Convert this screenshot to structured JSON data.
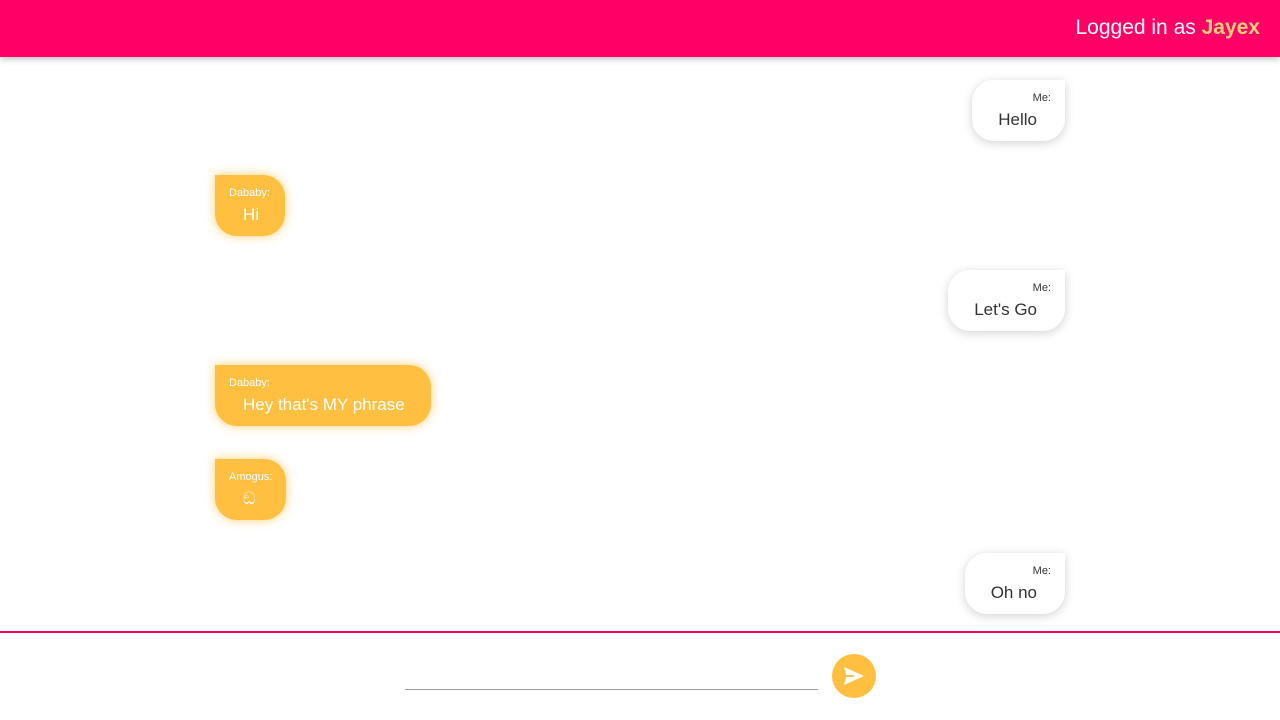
{
  "header": {
    "login_prefix": "Logged in as ",
    "username": "Jayex"
  },
  "messages": [
    {
      "sender": "Me:",
      "text": "Hello",
      "mine": true
    },
    {
      "sender": "Dababy:",
      "text": "Hi",
      "mine": false
    },
    {
      "sender": "Me:",
      "text": "Let's Go",
      "mine": true
    },
    {
      "sender": "Dababy:",
      "text": "Hey that's MY phrase",
      "mine": false
    },
    {
      "sender": "Amogus:",
      "text": "ඞ",
      "mine": false
    },
    {
      "sender": "Me:",
      "text": "Oh no",
      "mine": true
    }
  ],
  "composer": {
    "placeholder": "",
    "send_icon": "send-icon"
  },
  "colors": {
    "header": "#ff0066",
    "accent": "#ffbf40",
    "username": "#ffd27a"
  }
}
